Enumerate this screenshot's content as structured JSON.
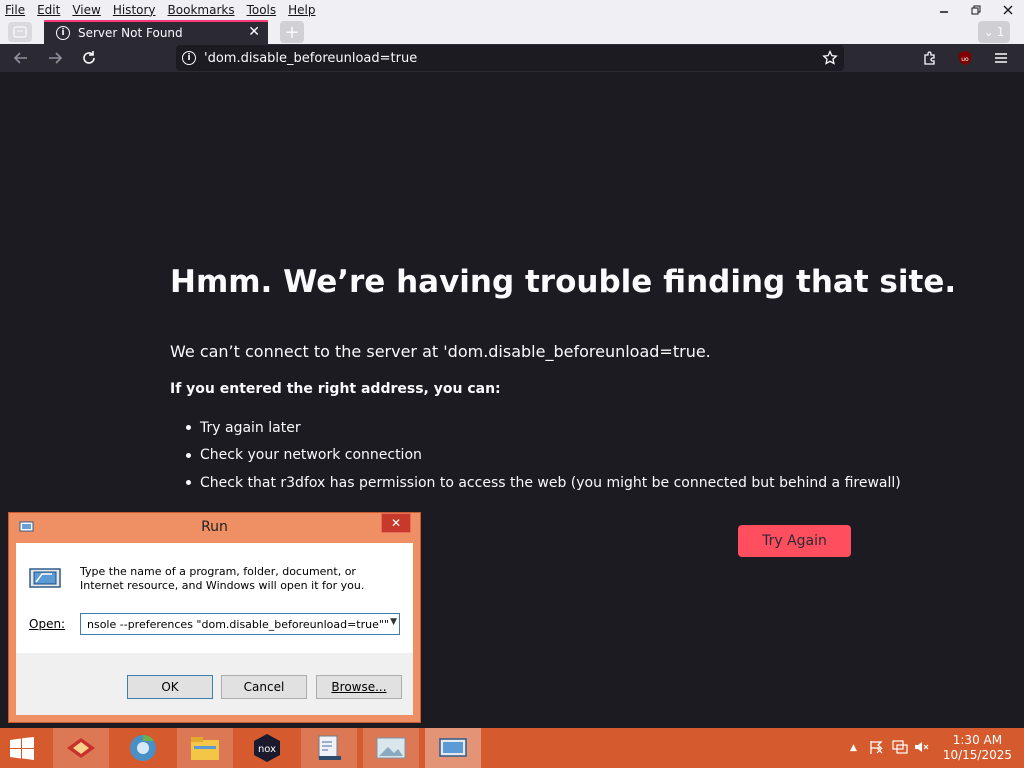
{
  "menubar": {
    "items": [
      "File",
      "Edit",
      "View",
      "History",
      "Bookmarks",
      "Tools",
      "Help"
    ]
  },
  "tab": {
    "title": "Server Not Found",
    "tab_count": "1"
  },
  "urlbar": {
    "text": "'dom.disable_beforeunload=true"
  },
  "error_page": {
    "title": "Hmm. We’re having trouble finding that site.",
    "description": "We can’t connect to the server at 'dom.disable_beforeunload=true.",
    "hint": "If you entered the right address, you can:",
    "suggestions": [
      "Try again later",
      "Check your network connection",
      "Check that r3dfox has permission to access the web (you might be connected but behind a firewall)"
    ],
    "try_again_label": "Try Again"
  },
  "run_dialog": {
    "title": "Run",
    "description": "Type the name of a program, folder, document, or Internet resource, and Windows will open it for you.",
    "open_label": "Open:",
    "open_value": "nsole --preferences \"dom.disable_beforeunload=true\"\"",
    "ok_label": "OK",
    "cancel_label": "Cancel",
    "browse_label": "Browse..."
  },
  "taskbar": {
    "apps": [
      "file-explorer-app",
      "chrome-app",
      "folder-app",
      "nox-app",
      "task-manager-app",
      "photos-app",
      "run-app"
    ],
    "clock_time": "1:30 AM",
    "clock_date": "10/15/2025"
  },
  "colors": {
    "page_bg": "#1c1b22",
    "toolbar_bg": "#2b2a33",
    "accent": "#ff4f5e",
    "taskbar": "#d55b2e",
    "dialog_frame": "#ef9064"
  }
}
